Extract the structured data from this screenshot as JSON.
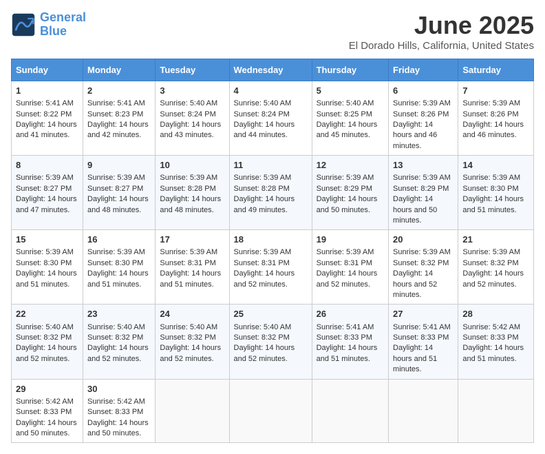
{
  "header": {
    "logo_line1": "General",
    "logo_line2": "Blue",
    "title": "June 2025",
    "subtitle": "El Dorado Hills, California, United States"
  },
  "days_of_week": [
    "Sunday",
    "Monday",
    "Tuesday",
    "Wednesday",
    "Thursday",
    "Friday",
    "Saturday"
  ],
  "weeks": [
    [
      {
        "day": 1,
        "sunrise": "Sunrise: 5:41 AM",
        "sunset": "Sunset: 8:22 PM",
        "daylight": "Daylight: 14 hours and 41 minutes."
      },
      {
        "day": 2,
        "sunrise": "Sunrise: 5:41 AM",
        "sunset": "Sunset: 8:23 PM",
        "daylight": "Daylight: 14 hours and 42 minutes."
      },
      {
        "day": 3,
        "sunrise": "Sunrise: 5:40 AM",
        "sunset": "Sunset: 8:24 PM",
        "daylight": "Daylight: 14 hours and 43 minutes."
      },
      {
        "day": 4,
        "sunrise": "Sunrise: 5:40 AM",
        "sunset": "Sunset: 8:24 PM",
        "daylight": "Daylight: 14 hours and 44 minutes."
      },
      {
        "day": 5,
        "sunrise": "Sunrise: 5:40 AM",
        "sunset": "Sunset: 8:25 PM",
        "daylight": "Daylight: 14 hours and 45 minutes."
      },
      {
        "day": 6,
        "sunrise": "Sunrise: 5:39 AM",
        "sunset": "Sunset: 8:26 PM",
        "daylight": "Daylight: 14 hours and 46 minutes."
      },
      {
        "day": 7,
        "sunrise": "Sunrise: 5:39 AM",
        "sunset": "Sunset: 8:26 PM",
        "daylight": "Daylight: 14 hours and 46 minutes."
      }
    ],
    [
      {
        "day": 8,
        "sunrise": "Sunrise: 5:39 AM",
        "sunset": "Sunset: 8:27 PM",
        "daylight": "Daylight: 14 hours and 47 minutes."
      },
      {
        "day": 9,
        "sunrise": "Sunrise: 5:39 AM",
        "sunset": "Sunset: 8:27 PM",
        "daylight": "Daylight: 14 hours and 48 minutes."
      },
      {
        "day": 10,
        "sunrise": "Sunrise: 5:39 AM",
        "sunset": "Sunset: 8:28 PM",
        "daylight": "Daylight: 14 hours and 48 minutes."
      },
      {
        "day": 11,
        "sunrise": "Sunrise: 5:39 AM",
        "sunset": "Sunset: 8:28 PM",
        "daylight": "Daylight: 14 hours and 49 minutes."
      },
      {
        "day": 12,
        "sunrise": "Sunrise: 5:39 AM",
        "sunset": "Sunset: 8:29 PM",
        "daylight": "Daylight: 14 hours and 50 minutes."
      },
      {
        "day": 13,
        "sunrise": "Sunrise: 5:39 AM",
        "sunset": "Sunset: 8:29 PM",
        "daylight": "Daylight: 14 hours and 50 minutes."
      },
      {
        "day": 14,
        "sunrise": "Sunrise: 5:39 AM",
        "sunset": "Sunset: 8:30 PM",
        "daylight": "Daylight: 14 hours and 51 minutes."
      }
    ],
    [
      {
        "day": 15,
        "sunrise": "Sunrise: 5:39 AM",
        "sunset": "Sunset: 8:30 PM",
        "daylight": "Daylight: 14 hours and 51 minutes."
      },
      {
        "day": 16,
        "sunrise": "Sunrise: 5:39 AM",
        "sunset": "Sunset: 8:30 PM",
        "daylight": "Daylight: 14 hours and 51 minutes."
      },
      {
        "day": 17,
        "sunrise": "Sunrise: 5:39 AM",
        "sunset": "Sunset: 8:31 PM",
        "daylight": "Daylight: 14 hours and 51 minutes."
      },
      {
        "day": 18,
        "sunrise": "Sunrise: 5:39 AM",
        "sunset": "Sunset: 8:31 PM",
        "daylight": "Daylight: 14 hours and 52 minutes."
      },
      {
        "day": 19,
        "sunrise": "Sunrise: 5:39 AM",
        "sunset": "Sunset: 8:31 PM",
        "daylight": "Daylight: 14 hours and 52 minutes."
      },
      {
        "day": 20,
        "sunrise": "Sunrise: 5:39 AM",
        "sunset": "Sunset: 8:32 PM",
        "daylight": "Daylight: 14 hours and 52 minutes."
      },
      {
        "day": 21,
        "sunrise": "Sunrise: 5:39 AM",
        "sunset": "Sunset: 8:32 PM",
        "daylight": "Daylight: 14 hours and 52 minutes."
      }
    ],
    [
      {
        "day": 22,
        "sunrise": "Sunrise: 5:40 AM",
        "sunset": "Sunset: 8:32 PM",
        "daylight": "Daylight: 14 hours and 52 minutes."
      },
      {
        "day": 23,
        "sunrise": "Sunrise: 5:40 AM",
        "sunset": "Sunset: 8:32 PM",
        "daylight": "Daylight: 14 hours and 52 minutes."
      },
      {
        "day": 24,
        "sunrise": "Sunrise: 5:40 AM",
        "sunset": "Sunset: 8:32 PM",
        "daylight": "Daylight: 14 hours and 52 minutes."
      },
      {
        "day": 25,
        "sunrise": "Sunrise: 5:40 AM",
        "sunset": "Sunset: 8:32 PM",
        "daylight": "Daylight: 14 hours and 52 minutes."
      },
      {
        "day": 26,
        "sunrise": "Sunrise: 5:41 AM",
        "sunset": "Sunset: 8:33 PM",
        "daylight": "Daylight: 14 hours and 51 minutes."
      },
      {
        "day": 27,
        "sunrise": "Sunrise: 5:41 AM",
        "sunset": "Sunset: 8:33 PM",
        "daylight": "Daylight: 14 hours and 51 minutes."
      },
      {
        "day": 28,
        "sunrise": "Sunrise: 5:42 AM",
        "sunset": "Sunset: 8:33 PM",
        "daylight": "Daylight: 14 hours and 51 minutes."
      }
    ],
    [
      {
        "day": 29,
        "sunrise": "Sunrise: 5:42 AM",
        "sunset": "Sunset: 8:33 PM",
        "daylight": "Daylight: 14 hours and 50 minutes."
      },
      {
        "day": 30,
        "sunrise": "Sunrise: 5:42 AM",
        "sunset": "Sunset: 8:33 PM",
        "daylight": "Daylight: 14 hours and 50 minutes."
      },
      null,
      null,
      null,
      null,
      null
    ]
  ]
}
